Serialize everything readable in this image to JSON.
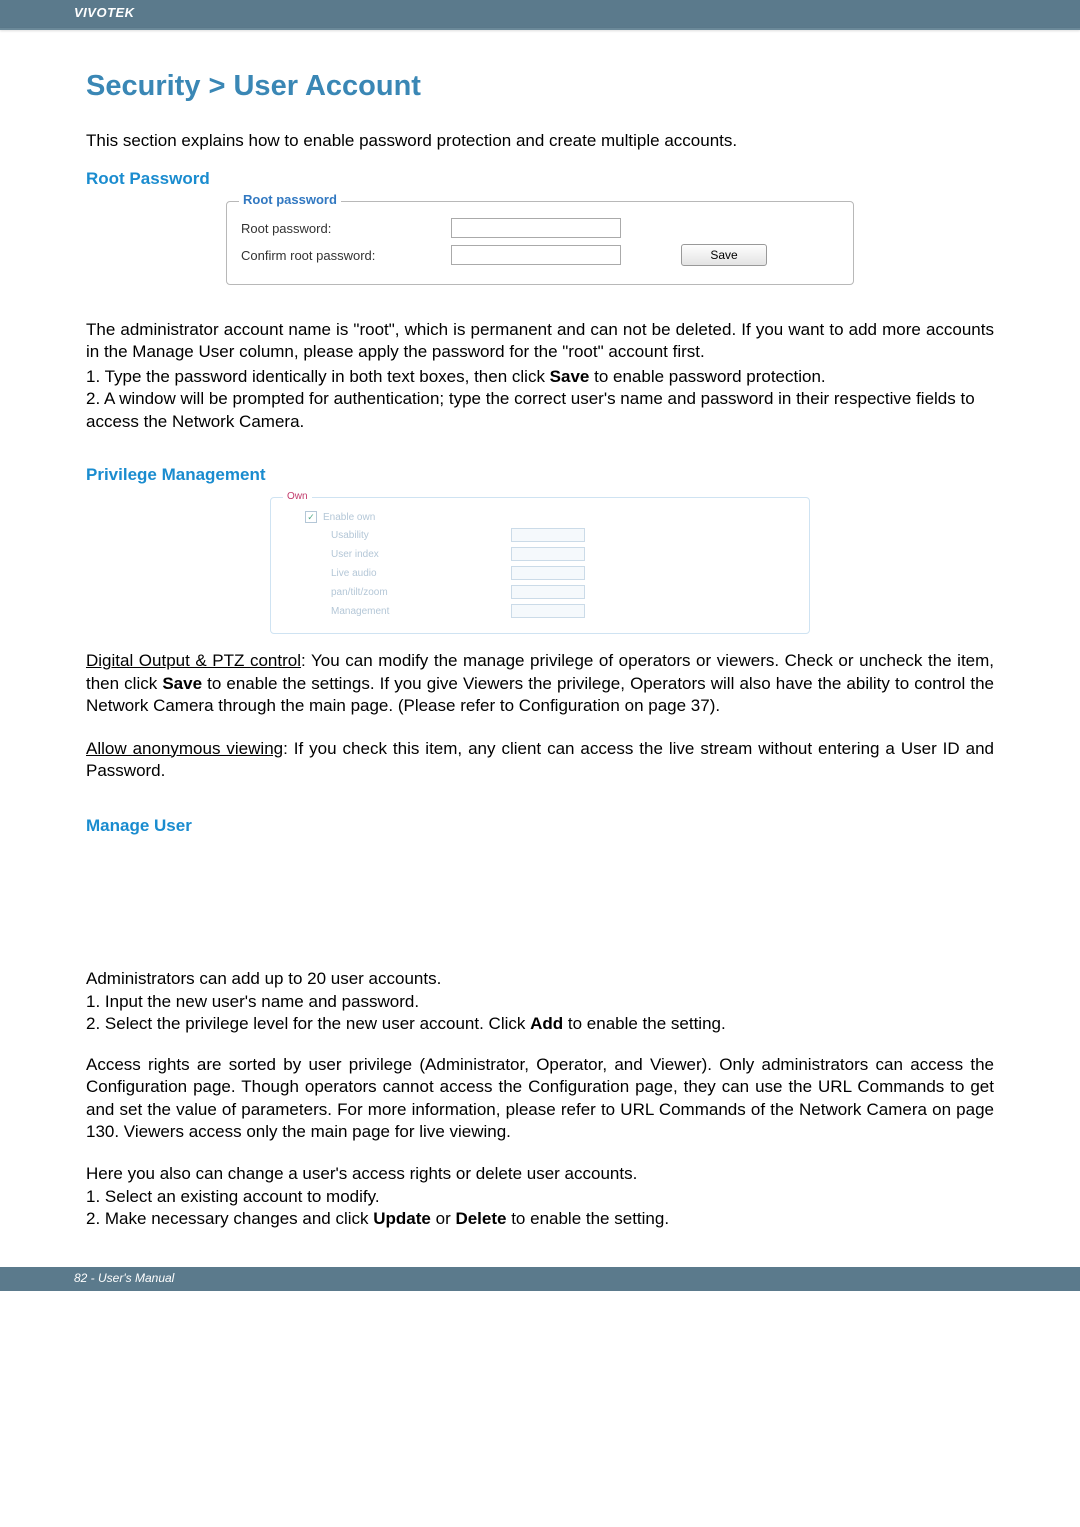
{
  "header": {
    "brand": "VIVOTEK"
  },
  "title": "Security > User Account",
  "intro": "This section explains how to enable password protection and create multiple accounts.",
  "rootPassword": {
    "heading": "Root Password",
    "legend": "Root password",
    "label1": "Root password:",
    "label2": "Confirm root password:",
    "saveLabel": "Save"
  },
  "rootDesc": {
    "para": "The administrator account name is \"root\", which is permanent and can not be deleted. If you want to add more accounts in the Manage User column, please apply the password for the \"root\" account first.",
    "step1_a": "1. Type the password identically in both text boxes, then click ",
    "step1_b": "Save",
    "step1_c": " to enable password protection.",
    "step2": "2. A window will be prompted for authentication; type the correct user's name and password in their respective fields to access the Network Camera."
  },
  "privilege": {
    "heading": "Privilege Management",
    "legend": "Own",
    "enableRow": "Enable own",
    "usability": "Usability",
    "userIndex": "User index",
    "liveAudio": "Live audio",
    "pantiltzoom": "pan/tilt/zoom",
    "management": "Management"
  },
  "digitalOutput": {
    "label": "Digital Output & PTZ control",
    "text_a": ": You can modify the manage privilege of operators or viewers. Check or uncheck the item, then click ",
    "save": "Save",
    "text_b": " to enable the settings. If you give Viewers the privilege, Operators will also have the ability to control the Network Camera through the main page. (Please refer to Configuration on page 37)."
  },
  "allowAnon": {
    "label": "Allow anonymous viewing",
    "text": ": If you check this item, any client can access the live stream without entering a User ID and Password."
  },
  "manageUser": {
    "heading": "Manage User",
    "p1": "Administrators can add up to 20 user accounts.",
    "s1": "1. Input the new user's name and password.",
    "s2_a": "2. Select the privilege level for the new user account. Click ",
    "s2_b": "Add",
    "s2_c": " to enable the setting.",
    "p2": "Access rights are sorted by user privilege (Administrator, Operator, and Viewer). Only administrators can access the Configuration page. Though operators cannot access the Configuration page, they can use the URL Commands to get and set the value of parameters. For more information, please refer to URL Commands of the Network Camera on page 130. Viewers access only the main page for live viewing.",
    "p3": "Here you also can change a user's access rights or delete user accounts.",
    "s3": "1. Select an existing account to modify.",
    "s4_a": "2. Make necessary changes and click ",
    "s4_b": "Update",
    "s4_c": " or ",
    "s4_d": "Delete",
    "s4_e": " to enable the setting."
  },
  "footer": {
    "text": "82 - User's Manual"
  }
}
